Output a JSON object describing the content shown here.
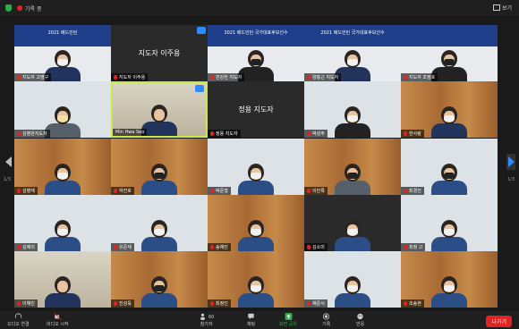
{
  "topbar": {
    "recording_label": "기록 중",
    "view_label": "보기"
  },
  "pager": {
    "left_page": "1/3",
    "right_page": "1/3"
  },
  "tiles": [
    {
      "row": 0,
      "col": 0,
      "name": "지도자 고영구",
      "style": "banner",
      "banner": "2021 배드민턴",
      "mask": "white",
      "body": "navy"
    },
    {
      "row": 0,
      "col": 1,
      "name": "지도자 이주용",
      "style": "dark",
      "center": "지도자 이주용"
    },
    {
      "row": 0,
      "col": 2,
      "name": "한강한 지도자",
      "style": "banner",
      "banner": "2021 배드민턴 국가대표후보선수",
      "mask": "black",
      "body": "black"
    },
    {
      "row": 0,
      "col": 3,
      "name": "양흥근 지도자",
      "style": "banner",
      "banner": "2021 배드민턴 국가대표후보선수",
      "mask": "white",
      "body": "navy"
    },
    {
      "row": 0,
      "col": 4,
      "name": "지도자 조정호",
      "style": "banner",
      "banner": "",
      "mask": "black",
      "body": "black"
    },
    {
      "row": 1,
      "col": 0,
      "name": "김병완지도자",
      "style": "light",
      "mask": "yellow",
      "body": "gray"
    },
    {
      "row": 1,
      "col": 1,
      "name": "Min Hwa Seo",
      "style": "room",
      "mask": "",
      "body": "navy",
      "active": true
    },
    {
      "row": 1,
      "col": 2,
      "name": "정용 지도자",
      "style": "dark",
      "center": "정용 지도자"
    },
    {
      "row": 1,
      "col": 3,
      "name": "박성주",
      "style": "light",
      "mask": "white",
      "body": "black"
    },
    {
      "row": 1,
      "col": 4,
      "name": "한사랑",
      "style": "wood",
      "mask": "white",
      "body": "navy"
    },
    {
      "row": 2,
      "col": 0,
      "name": "김병재",
      "style": "wood",
      "mask": "white",
      "body": "blue"
    },
    {
      "row": 2,
      "col": 1,
      "name": "하진호",
      "style": "wood",
      "mask": "black",
      "body": "blue"
    },
    {
      "row": 2,
      "col": 2,
      "name": "박준형",
      "style": "light",
      "mask": "white",
      "body": "blue"
    },
    {
      "row": 2,
      "col": 3,
      "name": "이민록",
      "style": "wood",
      "mask": "black",
      "body": "gray"
    },
    {
      "row": 2,
      "col": 4,
      "name": "최경진",
      "style": "light",
      "mask": "black",
      "body": "blue"
    },
    {
      "row": 3,
      "col": 0,
      "name": "김예리",
      "style": "light",
      "mask": "white",
      "body": "blue"
    },
    {
      "row": 3,
      "col": 1,
      "name": "유준재",
      "style": "light",
      "mask": "white",
      "body": "blue"
    },
    {
      "row": 3,
      "col": 2,
      "name": "송채민",
      "style": "wood",
      "mask": "white",
      "body": "blue"
    },
    {
      "row": 3,
      "col": 3,
      "name": "김소미",
      "style": "dark",
      "mask": "white",
      "body": "blue"
    },
    {
      "row": 3,
      "col": 4,
      "name": "최정 고",
      "style": "light",
      "mask": "white",
      "body": "blue"
    },
    {
      "row": 4,
      "col": 0,
      "name": "이혜빈",
      "style": "room",
      "mask": "",
      "body": "navy"
    },
    {
      "row": 4,
      "col": 1,
      "name": "진성욱",
      "style": "wood",
      "mask": "black",
      "body": "blue"
    },
    {
      "row": 4,
      "col": 2,
      "name": "최정인",
      "style": "wood",
      "mask": "white",
      "body": "blue"
    },
    {
      "row": 4,
      "col": 3,
      "name": "채준서",
      "style": "light",
      "mask": "white",
      "body": "blue"
    },
    {
      "row": 4,
      "col": 4,
      "name": "조송현",
      "style": "wood",
      "mask": "white",
      "body": "blue"
    }
  ],
  "toolbar": {
    "audio_label": "오디오 연결",
    "video_label": "비디오 시작",
    "participants_label": "참가자",
    "participants_count": "60",
    "chat_label": "채팅",
    "share_label": "화면 공유",
    "record_label": "기록",
    "reactions_label": "반응",
    "end_label": "나가기"
  }
}
